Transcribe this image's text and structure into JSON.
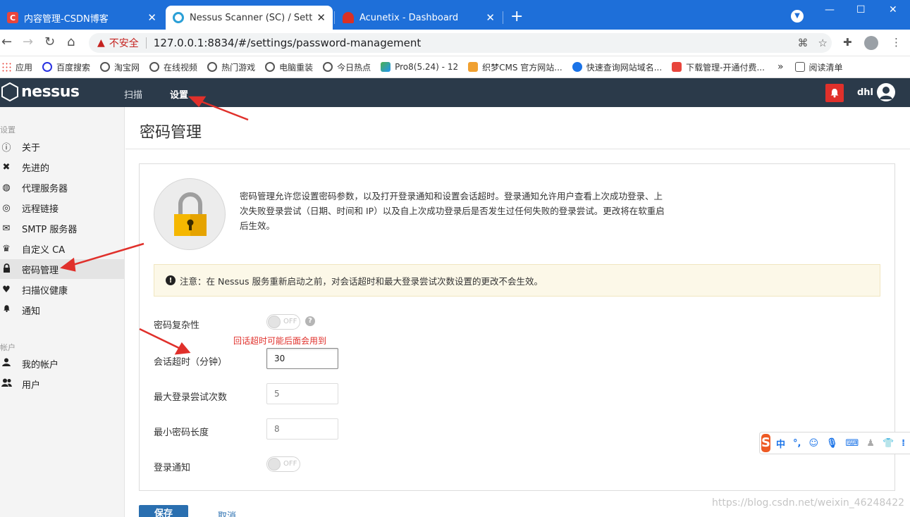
{
  "browser": {
    "tabs": [
      {
        "title": "内容管理-CSDN博客",
        "favicon": "C",
        "favicon_color": "#e8453c",
        "active": false
      },
      {
        "title": "Nessus Scanner (SC) / Settings",
        "favicon": "",
        "favicon_color": "#2a9fd6",
        "active": true
      },
      {
        "title": "Acunetix - Dashboard",
        "favicon": "",
        "favicon_color": "#d93025",
        "active": false
      }
    ],
    "new_tab_symbol": "+",
    "security_label": "不安全",
    "url": "127.0.0.1:8834/#/settings/password-management",
    "bookmarks": [
      {
        "label": "应用",
        "icon": "apps-icon"
      },
      {
        "label": "百度搜索",
        "icon": "baidu-paw-icon"
      },
      {
        "label": "淘宝网",
        "icon": "globe-icon"
      },
      {
        "label": "在线视频",
        "icon": "globe-icon"
      },
      {
        "label": "热门游戏",
        "icon": "globe-icon"
      },
      {
        "label": "电脑重装",
        "icon": "globe-icon"
      },
      {
        "label": "今日热点",
        "icon": "globe-icon"
      },
      {
        "label": "Pro8(5.24) - 12",
        "icon": "chart-icon"
      },
      {
        "label": "织梦CMS 官方网站...",
        "icon": "dede-icon"
      },
      {
        "label": "快速查询网站域名...",
        "icon": "search-icon"
      },
      {
        "label": "下载管理-开通付费...",
        "icon": "csdn-icon"
      }
    ],
    "reading_list": "阅读清单"
  },
  "app": {
    "logo_text": "nessus",
    "nav": {
      "scan": "扫描",
      "settings": "设置"
    },
    "username": "dhl",
    "accent_color": "#2b3a4a",
    "alert_color": "#e0302b"
  },
  "sidebar": {
    "section_settings": "设置",
    "items": [
      {
        "label": "关于",
        "icon": "info-icon"
      },
      {
        "label": "先进的",
        "icon": "tools-icon"
      },
      {
        "label": "代理服务器",
        "icon": "globe-icon"
      },
      {
        "label": "远程链接",
        "icon": "link-icon"
      },
      {
        "label": "SMTP 服务器",
        "icon": "mail-icon"
      },
      {
        "label": "自定义 CA",
        "icon": "certificate-icon"
      },
      {
        "label": "密码管理",
        "icon": "lock-icon",
        "active": true
      },
      {
        "label": "扫描仪健康",
        "icon": "heartbeat-icon"
      },
      {
        "label": "通知",
        "icon": "bell-icon"
      }
    ],
    "section_accounts": "帐户",
    "account_items": [
      {
        "label": "我的帐户",
        "icon": "user-icon"
      },
      {
        "label": "用户",
        "icon": "users-icon"
      }
    ]
  },
  "main": {
    "title": "密码管理",
    "description": "密码管理允许您设置密码参数，以及打开登录通知和设置会话超时。登录通知允许用户查看上次成功登录、上次失败登录尝试（日期、时间和 IP）以及自上次成功登录后是否发生过任何失败的登录尝试。更改将在软重启后生效。",
    "notice": "注意：在 Nessus 服务重新启动之前，对会话超时和最大登录尝试次数设置的更改不会生效。",
    "fields": {
      "password_complexity": {
        "label": "密码复杂性",
        "toggle": "OFF"
      },
      "session_timeout": {
        "label": "会话超时（分钟）",
        "value": "30"
      },
      "max_login_attempts": {
        "label": "最大登录尝试次数",
        "placeholder": "5"
      },
      "min_password_length": {
        "label": "最小密码长度",
        "placeholder": "8"
      },
      "login_notification": {
        "label": "登录通知",
        "toggle": "OFF"
      }
    },
    "save_label": "保存",
    "cancel_label": "取消"
  },
  "annotation_note": "回话超时可能后面会用到",
  "watermark": "https://blog.csdn.net/weixin_46248422",
  "ime": {
    "logo": "S",
    "items": [
      "中",
      "°,"
    ]
  }
}
